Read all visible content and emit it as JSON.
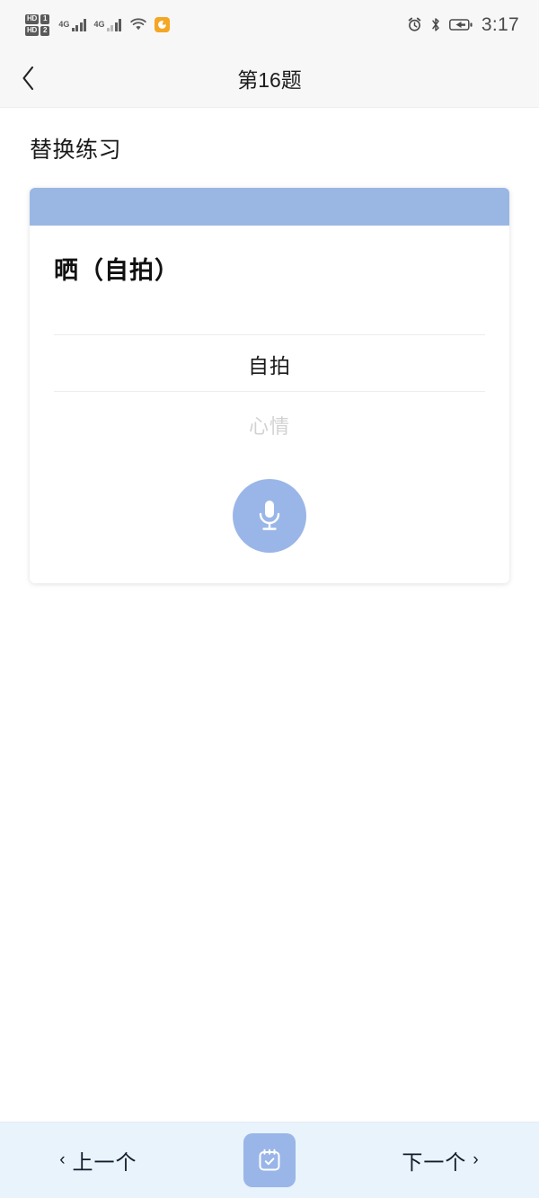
{
  "status_bar": {
    "hd_labels": [
      "HD",
      "HD"
    ],
    "sim_labels": [
      "1",
      "2"
    ],
    "network_type_1": "4G",
    "network_type_2": "4G",
    "icons": [
      "wifi-icon",
      "orange-app-icon",
      "alarm-icon",
      "bluetooth-icon",
      "battery-charging-icon"
    ],
    "time": "3:17"
  },
  "header": {
    "back_icon": "chevron-left-icon",
    "title": "第16题"
  },
  "main": {
    "section_title": "替换练习",
    "card": {
      "prompt": "晒（自拍）",
      "answer_value": "自拍",
      "answer_placeholder": "心情",
      "mic_icon": "microphone-icon"
    }
  },
  "bottom_bar": {
    "prev_label": "上一个",
    "prev_chevron": "‹",
    "next_label": "下一个",
    "next_chevron": "›",
    "center_icon": "clipboard-check-icon"
  },
  "colors": {
    "card_band": "#9ab7e4",
    "accent_blue": "#9ab6e8",
    "bottom_bar_bg": "#e8f3fb",
    "header_bg": "#f7f7f7",
    "placeholder_gray": "#d2d2d2"
  }
}
